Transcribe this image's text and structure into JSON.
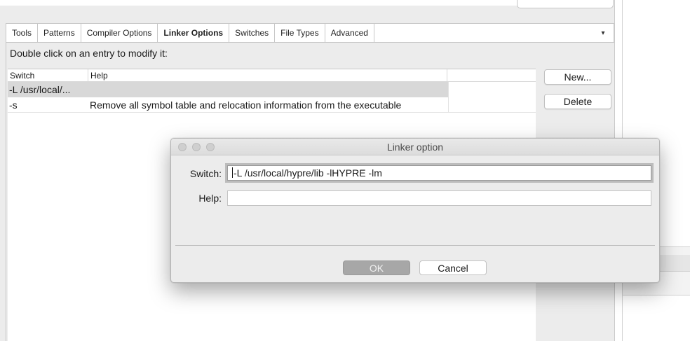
{
  "tabs": [
    {
      "label": "Tools"
    },
    {
      "label": "Patterns"
    },
    {
      "label": "Compiler Options"
    },
    {
      "label": "Linker Options",
      "active": true
    },
    {
      "label": "Switches"
    },
    {
      "label": "File Types"
    },
    {
      "label": "Advanced"
    }
  ],
  "tab_menu_icon": "▾",
  "instruction": "Double click on an entry to modify it:",
  "table": {
    "headers": [
      "Switch",
      "Help"
    ],
    "rows": [
      {
        "switch": "-L /usr/local/...",
        "help": "",
        "selected": true
      },
      {
        "switch": "-s",
        "help": "Remove all symbol table and relocation information from the executable",
        "selected": false
      }
    ]
  },
  "buttons": {
    "new": "New...",
    "delete": "Delete"
  },
  "dialog": {
    "title": "Linker option",
    "switch_label": "Switch:",
    "switch_value": "-L /usr/local/hypre/lib -lHYPRE -lm",
    "help_label": "Help:",
    "help_value": "",
    "ok": "OK",
    "cancel": "Cancel"
  }
}
